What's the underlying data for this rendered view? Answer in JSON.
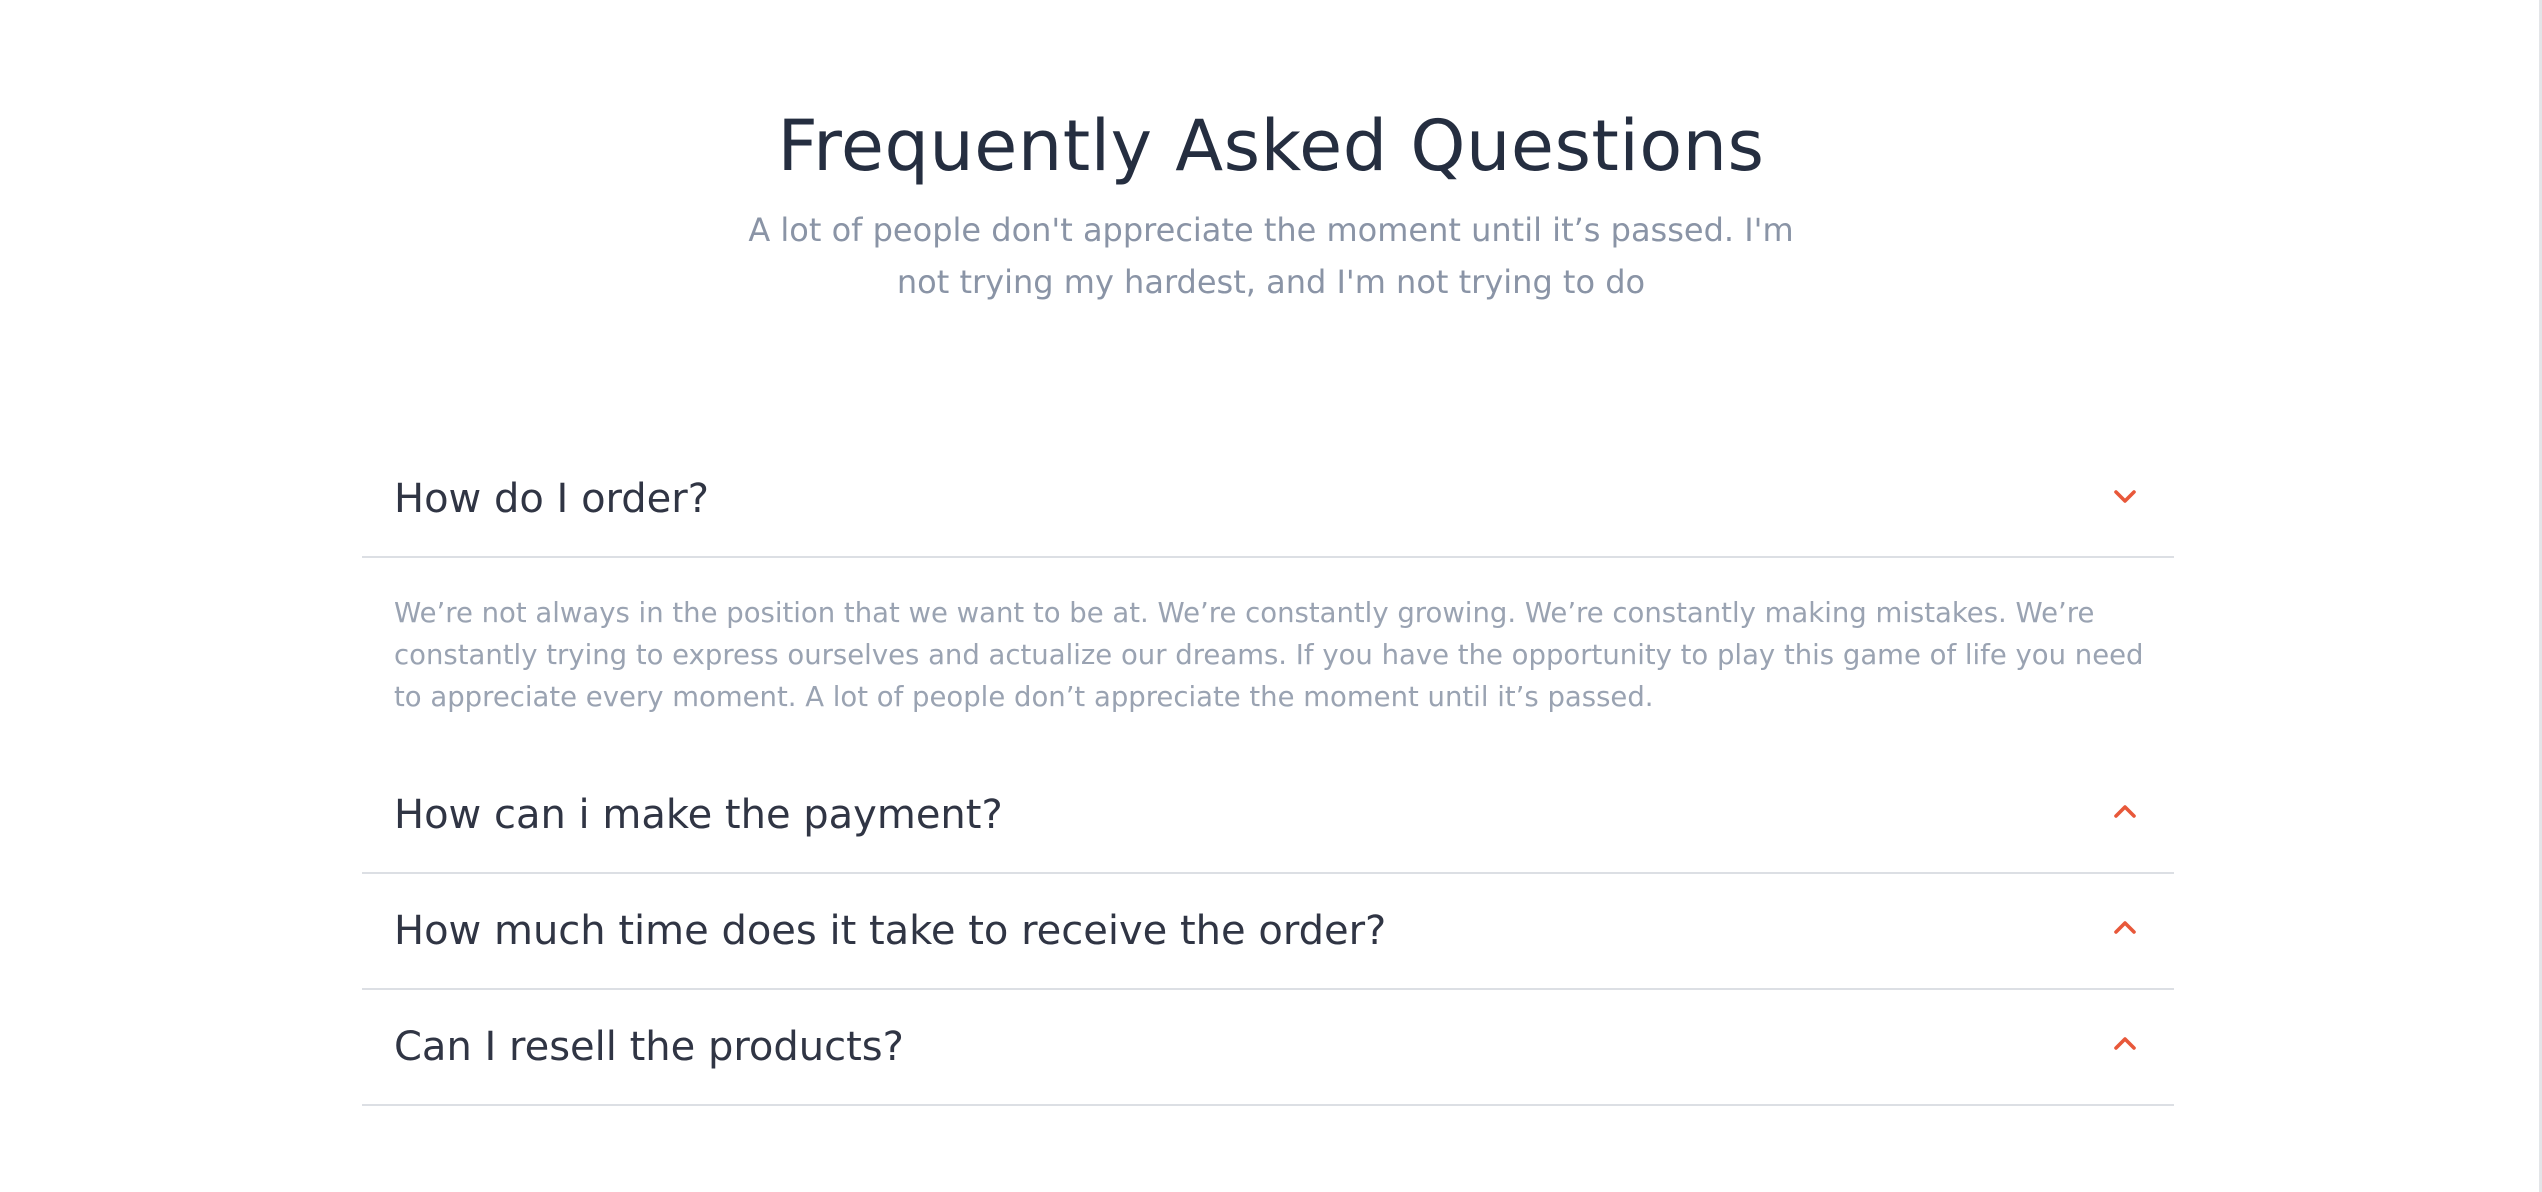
{
  "header": {
    "title": "Frequently Asked Questions",
    "subtitle": "A lot of people don't appreciate the moment until it’s passed. I'm not trying my hardest, and I'm not trying to do"
  },
  "colors": {
    "accent": "#e8583a",
    "title": "#252e40",
    "muted": "#8a94a6",
    "divider": "#dcdfe4"
  },
  "faq": {
    "items": [
      {
        "question": "How do I order?",
        "answer": "We’re not always in the position that we want to be at. We’re constantly growing. We’re constantly making mistakes. We’re constantly trying to express ourselves and actualize our dreams. If you have the opportunity to play this game of life you need to appreciate every moment. A lot of people don’t appreciate the moment until it’s passed.",
        "expanded": true,
        "icon": "chevron-down-icon"
      },
      {
        "question": "How can i make the payment?",
        "expanded": false,
        "icon": "chevron-up-icon"
      },
      {
        "question": "How much time does it take to receive the order?",
        "expanded": false,
        "icon": "chevron-up-icon"
      },
      {
        "question": "Can I resell the products?",
        "expanded": false,
        "icon": "chevron-up-icon"
      }
    ]
  }
}
